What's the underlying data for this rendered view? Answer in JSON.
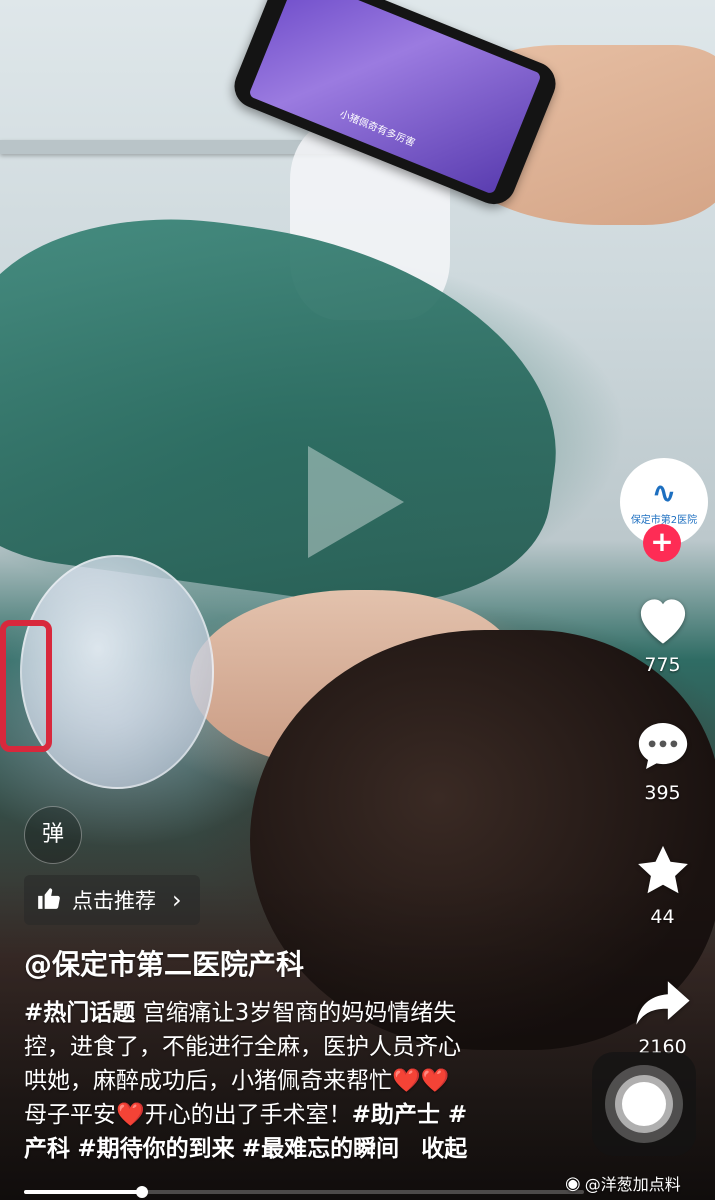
{
  "video": {
    "phone_caption": "小猪佩奇有多厉害"
  },
  "sidebar": {
    "avatar_label": "保定市第2医院",
    "follow_symbol": "+",
    "likes": "775",
    "comments": "395",
    "favorites": "44",
    "shares": "2160"
  },
  "overlay": {
    "danmu_label": "弹",
    "recommend_label": "点击推荐",
    "recommend_chevron": "›"
  },
  "post": {
    "author": "@保定市第二医院产科",
    "lines": [
      [
        "#热门话题",
        " 宫缩痛让3岁智商的妈妈情绪失"
      ],
      [
        "控，进食了，不能进行全麻，医护人员齐心"
      ],
      [
        "哄她，麻醉成功后，小猪佩奇来帮忙",
        "❤️",
        "❤️"
      ],
      [
        "母子平安",
        "❤️",
        "开心的出了手术室！",
        "#助产士",
        " #"
      ],
      [
        "产科",
        " ",
        "#期待你的到来",
        " ",
        "#最难忘的瞬间",
        "收起"
      ]
    ],
    "text": {
      "l1_tag": "#热门话题",
      "l1_rest": " 宫缩痛让3岁智商的妈妈情绪失",
      "l2": "控，进食了，不能进行全麻，医护人员齐心",
      "l3": "哄她，麻醉成功后，小猪佩奇来帮忙",
      "heart": "❤️",
      "l4_a": "母子平安",
      "l4_b": "开心的出了手术室！",
      "l4_tag": "#助产士",
      "l4_hash": " #",
      "l5_a": "产科",
      "l5_tag1": "#期待你的到来",
      "l5_tag2": "#最难忘的瞬间",
      "collapse": "收起"
    }
  },
  "progress": {
    "fraction": 0.21
  },
  "watermark": {
    "icon": "weibo-icon",
    "text": "@洋葱加点料"
  },
  "colors": {
    "follow": "#fe2c55",
    "heart_emoji": "#ff2a2a",
    "avatar_blue": "#1d6fc0"
  }
}
